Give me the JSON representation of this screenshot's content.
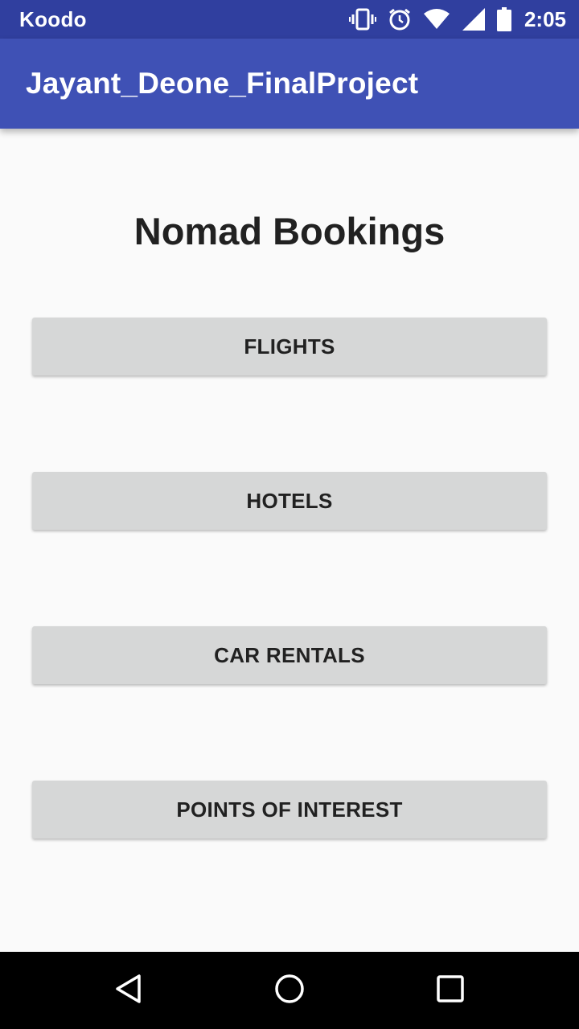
{
  "status_bar": {
    "carrier": "Koodo",
    "time": "2:05",
    "icons": [
      "vibrate-icon",
      "alarm-icon",
      "wifi-icon",
      "cell-signal-icon",
      "battery-icon"
    ]
  },
  "app_bar": {
    "title": "Jayant_Deone_FinalProject"
  },
  "main": {
    "title": "Nomad Bookings",
    "buttons": [
      {
        "label": "FLIGHTS"
      },
      {
        "label": "HOTELS"
      },
      {
        "label": "CAR RENTALS"
      },
      {
        "label": "POINTS OF INTEREST"
      }
    ]
  },
  "nav_bar": {
    "icons": [
      "back-icon",
      "home-icon",
      "recents-icon"
    ]
  },
  "colors": {
    "status_bar": "#303f9f",
    "app_bar": "#3f51b5",
    "background": "#fafafa",
    "button": "#d6d7d7",
    "nav_bar": "#000000"
  }
}
